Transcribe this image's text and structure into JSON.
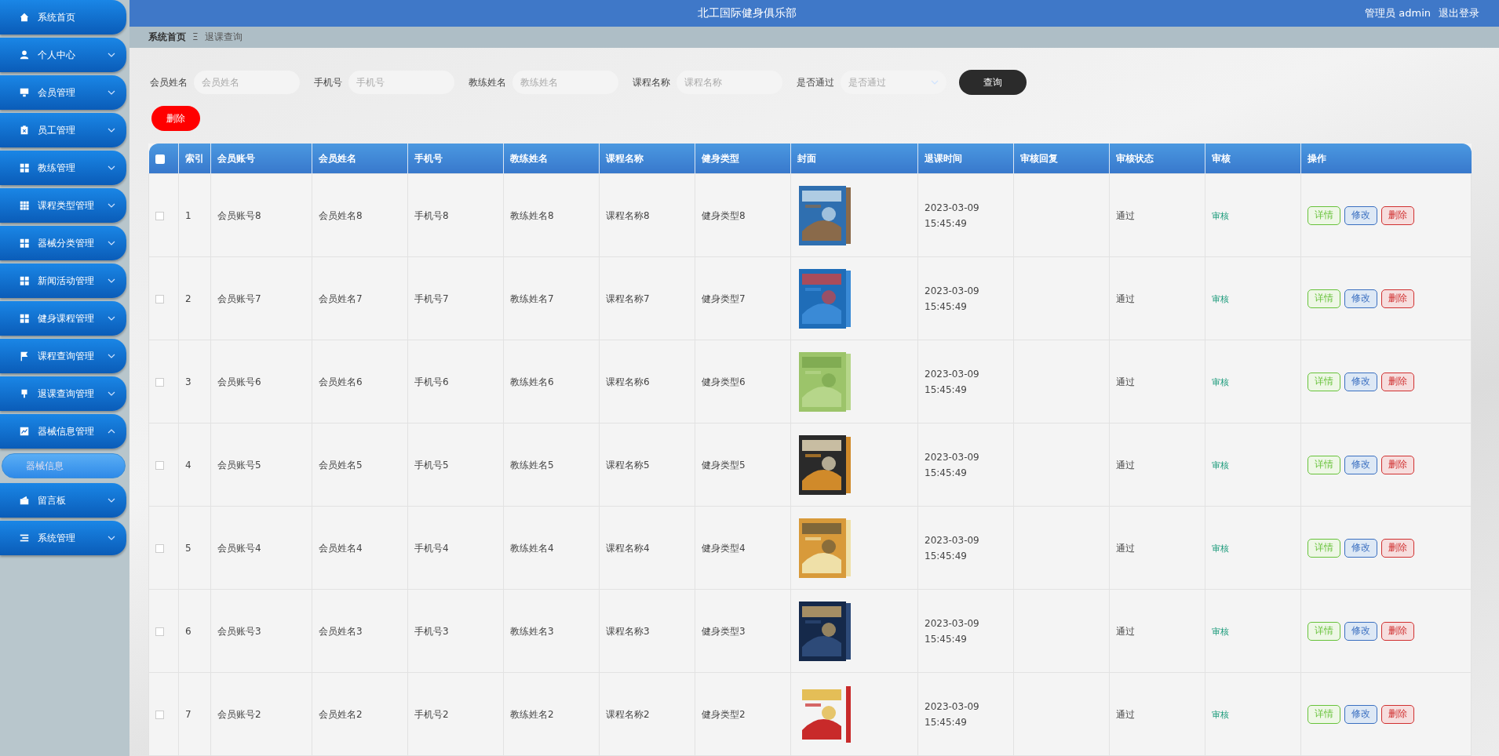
{
  "sidebar": {
    "items": [
      {
        "label": "系统首页",
        "kind": "link"
      },
      {
        "label": "个人中心",
        "kind": "menu",
        "expanded": false
      },
      {
        "label": "会员管理",
        "kind": "menu",
        "expanded": false
      },
      {
        "label": "员工管理",
        "kind": "menu",
        "expanded": false
      },
      {
        "label": "教练管理",
        "kind": "menu",
        "expanded": false
      },
      {
        "label": "课程类型管理",
        "kind": "menu",
        "expanded": false
      },
      {
        "label": "器械分类管理",
        "kind": "menu",
        "expanded": false
      },
      {
        "label": "新闻活动管理",
        "kind": "menu",
        "expanded": false
      },
      {
        "label": "健身课程管理",
        "kind": "menu",
        "expanded": false
      },
      {
        "label": "课程查询管理",
        "kind": "menu",
        "expanded": false
      },
      {
        "label": "退课查询管理",
        "kind": "menu",
        "expanded": false
      },
      {
        "label": "器械信息管理",
        "kind": "menu",
        "expanded": true,
        "children": [
          {
            "label": "器械信息"
          }
        ]
      },
      {
        "label": "留言板",
        "kind": "menu",
        "expanded": false
      },
      {
        "label": "系统管理",
        "kind": "menu",
        "expanded": false
      }
    ]
  },
  "header": {
    "title": "北工国际健身俱乐部",
    "user": "管理员 admin",
    "logout": "退出登录"
  },
  "breadcrumb": {
    "home": "系统首页",
    "separator": "Ξ",
    "current": "退课查询"
  },
  "search": {
    "fields": [
      {
        "label": "会员姓名",
        "placeholder": "会员姓名",
        "kind": "text"
      },
      {
        "label": "手机号",
        "placeholder": "手机号",
        "kind": "text"
      },
      {
        "label": "教练姓名",
        "placeholder": "教练姓名",
        "kind": "text"
      },
      {
        "label": "课程名称",
        "placeholder": "课程名称",
        "kind": "text"
      },
      {
        "label": "是否通过",
        "placeholder": "是否通过",
        "kind": "select"
      }
    ],
    "button": "查询"
  },
  "delete_button": "删除",
  "table": {
    "select_all": {
      "checked": false
    },
    "columns": [
      "索引",
      "会员账号",
      "会员姓名",
      "手机号",
      "教练姓名",
      "课程名称",
      "健身类型",
      "封面",
      "退课时间",
      "审核回复",
      "审核状态",
      "审核",
      "操作"
    ],
    "rows": [
      {
        "checked": false,
        "index": "1",
        "account": "会员账号8",
        "name": "会员姓名8",
        "phone": "手机号8",
        "coach": "教练姓名8",
        "course": "课程名称8",
        "type": "健身类型8",
        "time": "2023-03-09 15:45:49",
        "status": "通过",
        "audit": "审核",
        "actions": [
          "详情",
          "修改",
          "删除"
        ]
      },
      {
        "checked": false,
        "index": "2",
        "account": "会员账号7",
        "name": "会员姓名7",
        "phone": "手机号7",
        "coach": "教练姓名7",
        "course": "课程名称7",
        "type": "健身类型7",
        "time": "2023-03-09 15:45:49",
        "status": "通过",
        "audit": "审核",
        "actions": [
          "详情",
          "修改",
          "删除"
        ]
      },
      {
        "checked": false,
        "index": "3",
        "account": "会员账号6",
        "name": "会员姓名6",
        "phone": "手机号6",
        "coach": "教练姓名6",
        "course": "课程名称6",
        "type": "健身类型6",
        "time": "2023-03-09 15:45:49",
        "status": "通过",
        "audit": "审核",
        "actions": [
          "详情",
          "修改",
          "删除"
        ]
      },
      {
        "checked": false,
        "index": "4",
        "account": "会员账号5",
        "name": "会员姓名5",
        "phone": "手机号5",
        "coach": "教练姓名5",
        "course": "课程名称5",
        "type": "健身类型5",
        "time": "2023-03-09 15:45:49",
        "status": "通过",
        "audit": "审核",
        "actions": [
          "详情",
          "修改",
          "删除"
        ]
      },
      {
        "checked": false,
        "index": "5",
        "account": "会员账号4",
        "name": "会员姓名4",
        "phone": "手机号4",
        "coach": "教练姓名4",
        "course": "课程名称4",
        "type": "健身类型4",
        "time": "2023-03-09 15:45:49",
        "status": "通过",
        "audit": "审核",
        "actions": [
          "详情",
          "修改",
          "删除"
        ]
      },
      {
        "checked": false,
        "index": "6",
        "account": "会员账号3",
        "name": "会员姓名3",
        "phone": "手机号3",
        "coach": "教练姓名3",
        "course": "课程名称3",
        "type": "健身类型3",
        "time": "2023-03-09 15:45:49",
        "status": "通过",
        "audit": "审核",
        "actions": [
          "详情",
          "修改",
          "删除"
        ]
      },
      {
        "checked": false,
        "index": "7",
        "account": "会员账号2",
        "name": "会员姓名2",
        "phone": "手机号2",
        "coach": "教练姓名2",
        "course": "课程名称2",
        "type": "健身类型2",
        "time": "2023-03-09 15:45:49",
        "status": "通过",
        "audit": "审核",
        "actions": [
          "详情",
          "修改",
          "删除"
        ]
      }
    ]
  }
}
